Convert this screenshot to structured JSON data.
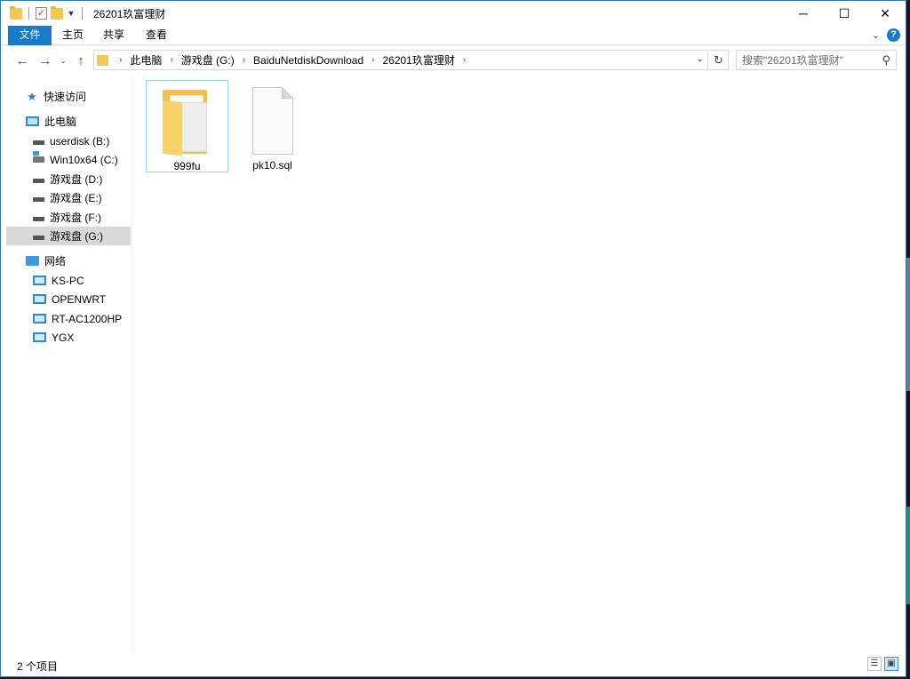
{
  "window": {
    "title": "26201玖富理财",
    "controls": {
      "minimize": "─",
      "maximize": "☐",
      "close": "✕"
    }
  },
  "ribbon": {
    "tabs": [
      {
        "label": "文件"
      },
      {
        "label": "主页"
      },
      {
        "label": "共享"
      },
      {
        "label": "查看"
      }
    ],
    "expand_icon": "chevron-down-icon",
    "help_label": "?"
  },
  "address_bar": {
    "breadcrumb": [
      "此电脑",
      "游戏盘 (G:)",
      "BaiduNetdiskDownload",
      "26201玖富理财"
    ],
    "search_placeholder": "搜索\"26201玖富理财\""
  },
  "nav_pane": {
    "quick_access": "快速访问",
    "this_pc": "此电脑",
    "drives": [
      {
        "label": "userdisk (B:)"
      },
      {
        "label": "Win10x64 (C:)"
      },
      {
        "label": "游戏盘 (D:)"
      },
      {
        "label": "游戏盘 (E:)"
      },
      {
        "label": "游戏盘 (F:)"
      },
      {
        "label": "游戏盘 (G:)",
        "selected": true
      }
    ],
    "network": "网络",
    "computers": [
      {
        "label": "KS-PC"
      },
      {
        "label": "OPENWRT"
      },
      {
        "label": "RT-AC1200HP"
      },
      {
        "label": "YGX"
      }
    ]
  },
  "files": [
    {
      "name": "999fu",
      "type": "folder",
      "selected": true
    },
    {
      "name": "pk10.sql",
      "type": "file"
    }
  ],
  "status": {
    "count": "2 个项目"
  },
  "colors": {
    "accent": "#1979ca",
    "selection_border": "#99d1ff",
    "nav_selected": "#d9d9d9",
    "folder": "#f0c04a"
  }
}
